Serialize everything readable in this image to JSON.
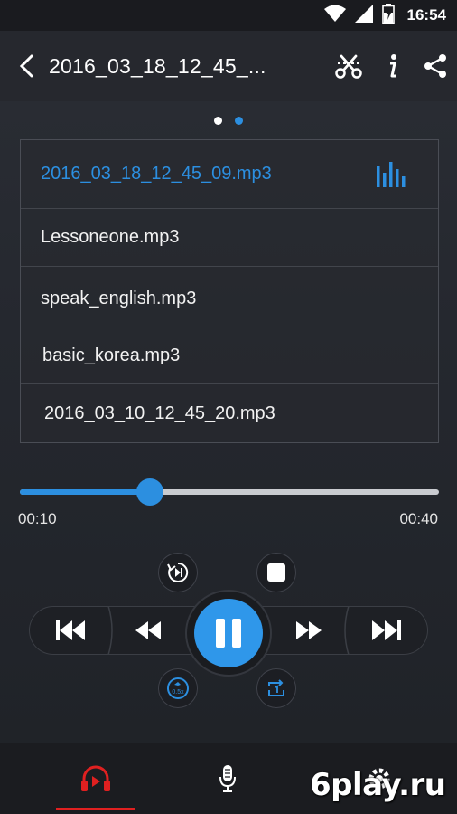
{
  "status_bar": {
    "time": "16:54",
    "icons": [
      "wifi-icon",
      "signal-icon",
      "battery-charging-icon"
    ]
  },
  "app_bar": {
    "title": "2016_03_18_12_45_...",
    "icons": [
      "back-icon",
      "scissors-icon",
      "info-icon",
      "share-icon"
    ]
  },
  "pager": {
    "dots": 2,
    "active": 1
  },
  "playlist": {
    "items": [
      {
        "name": "2016_03_18_12_45_09.mp3",
        "active": true
      },
      {
        "name": "Lessoneone.mp3",
        "active": false
      },
      {
        "name": "speak_english.mp3",
        "active": false
      },
      {
        "name": "basic_korea.mp3",
        "active": false
      },
      {
        "name": "2016_03_10_12_45_20.mp3",
        "active": false
      }
    ]
  },
  "player": {
    "current_time": "00:10",
    "total_time": "00:40",
    "progress": 0.31,
    "speed_label": "0.5x"
  },
  "bottom_nav": {
    "items": [
      "player-icon",
      "microphone-icon",
      "settings-icon"
    ],
    "active": 0
  },
  "watermark": "6play.ru",
  "colors": {
    "accent": "#2c8fe0",
    "nav_active": "#e02020",
    "background": "#26282e"
  }
}
